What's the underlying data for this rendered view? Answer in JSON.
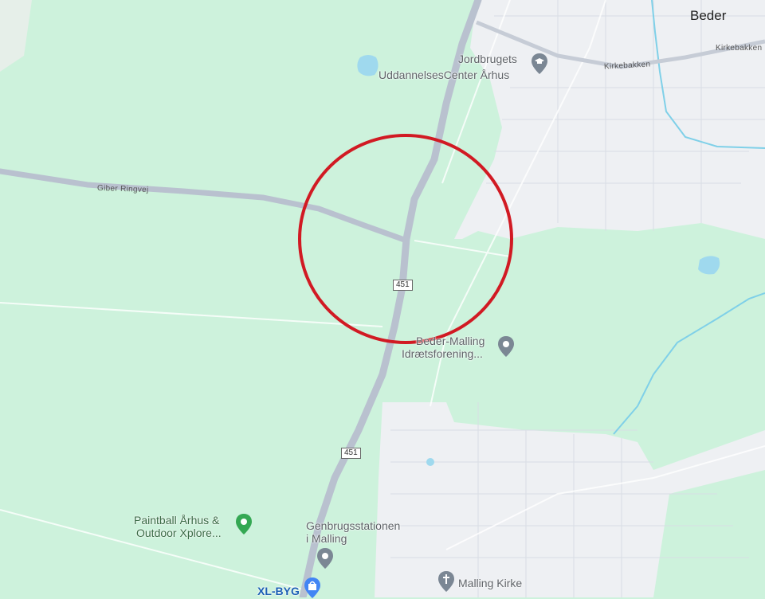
{
  "places": {
    "beder": "Beder",
    "kirkebakken_1": "Kirkebakken",
    "kirkebakken_2": "Kirkebakken",
    "giber_ringvej": "Giber Ringvej",
    "road_451_a": "451",
    "road_451_b": "451"
  },
  "pois": {
    "jordbrugets_line1": "Jordbrugets",
    "jordbrugets_line2": "UddannelsesCenter Århus",
    "beder_malling_line1": "Beder-Malling",
    "beder_malling_line2": "Idrætsforening...",
    "paintball_line1": "Paintball Århus &",
    "paintball_line2": "Outdoor Xplore...",
    "genbrug_line1": "Genbrugsstationen",
    "genbrug_line2": "i Malling",
    "malling_kirke": "Malling Kirke",
    "xl_byg": "XL-BYG"
  },
  "icons": {
    "school": "graduation-cap-icon",
    "sports": "place-pin-icon",
    "park": "park-pin-icon",
    "recycling": "place-pin-icon",
    "church": "cross-pin-icon",
    "shop": "shopping-bag-icon"
  },
  "colors": {
    "green_area": "#cdf2dc",
    "urban": "#eef0f3",
    "highway": "#b9c1cf",
    "water": "#9fd9ee",
    "highlight_circle": "#d11a23"
  }
}
